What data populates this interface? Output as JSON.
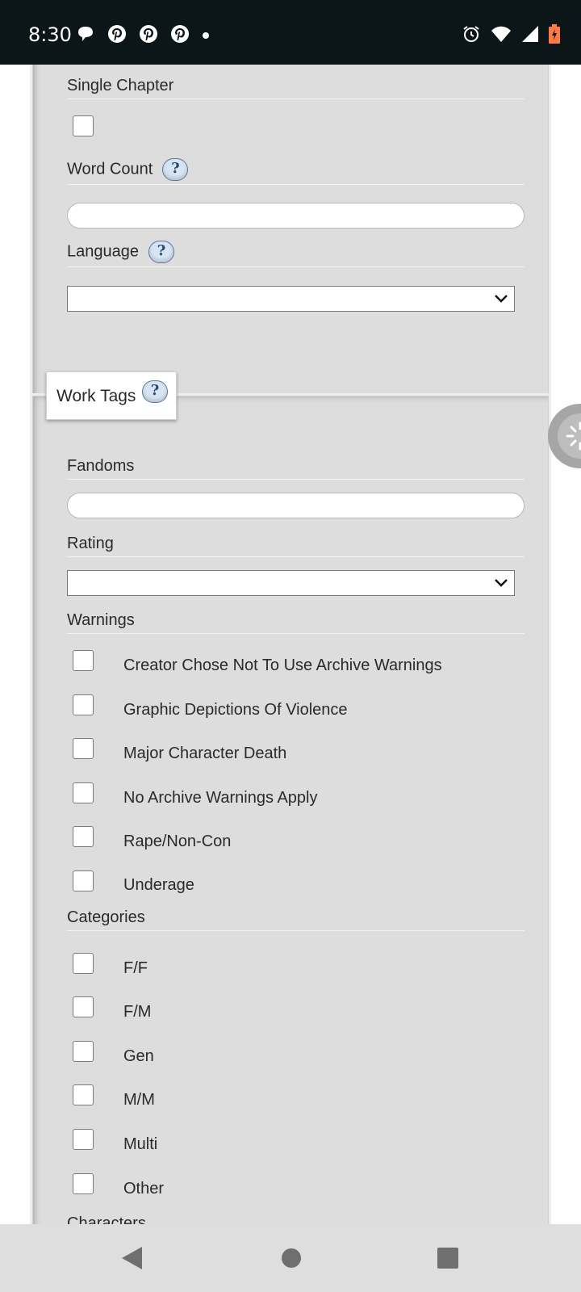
{
  "status_bar": {
    "time": "8:30",
    "notification_icons": [
      "chat-bubble-icon",
      "pinterest-icon",
      "pinterest-icon",
      "pinterest-icon",
      "dot-icon"
    ],
    "system_icons": [
      "alarm-icon",
      "wifi-icon",
      "signal-icon",
      "battery-charging-icon"
    ]
  },
  "search_form": {
    "single_chapter": {
      "label": "Single Chapter",
      "checked": false
    },
    "word_count": {
      "label": "Word Count",
      "help": "?",
      "value": ""
    },
    "language": {
      "label": "Language",
      "help": "?",
      "selected": ""
    },
    "work_tags": {
      "legend": "Work Tags",
      "help": "?",
      "fandoms": {
        "label": "Fandoms",
        "value": ""
      },
      "rating": {
        "label": "Rating",
        "selected": ""
      },
      "warnings": {
        "label": "Warnings",
        "options": [
          "Creator Chose Not To Use Archive Warnings",
          "Graphic Depictions Of Violence",
          "Major Character Death",
          "No Archive Warnings Apply",
          "Rape/Non-Con",
          "Underage"
        ]
      },
      "categories": {
        "label": "Categories",
        "options": [
          "F/F",
          "F/M",
          "Gen",
          "M/M",
          "Multi",
          "Other"
        ]
      },
      "characters": {
        "label": "Characters"
      }
    }
  },
  "navigation": {
    "buttons": [
      "back-icon",
      "home-icon",
      "recents-icon"
    ]
  },
  "colors": {
    "panel_bg": "#dddddd",
    "status_bar_bg": "#0c1619",
    "help_bg": "#d6e4f3",
    "nav_bar_bg": "#dedede"
  }
}
